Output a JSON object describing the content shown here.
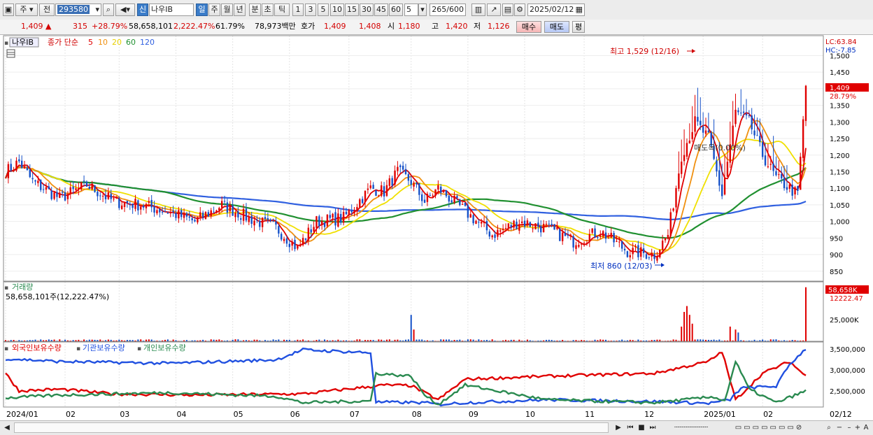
{
  "toolbar": {
    "type1": "주",
    "type2": "전",
    "code": "293580",
    "name": "나우IB",
    "new_label": "신",
    "periods": [
      "일",
      "주",
      "월",
      "년",
      "분",
      "초",
      "틱"
    ],
    "intervals": [
      "1",
      "3",
      "5",
      "10",
      "15",
      "30",
      "45",
      "60"
    ],
    "interval_value": "5",
    "count": "265/600",
    "date": "2025/02/12"
  },
  "quote": {
    "price": "1,409 ▲",
    "change": "315",
    "change_pct": "+28.79%",
    "volume": "58,658,101",
    "volume_pct": "2,222.47%",
    "turnover": "61.79%",
    "amount": "78,973백만",
    "bid_label": "호가",
    "ask": "1,409",
    "bid": "1,408",
    "open_label": "시",
    "open": "1,180",
    "high_label": "고",
    "high": "1,420",
    "low_label": "저",
    "low": "1,126",
    "buy": "매수",
    "sell": "매도",
    "flat": "평"
  },
  "price_panel": {
    "name_tag": "나우IB",
    "legend_title": "종가 단순",
    "ma_labels": [
      "5",
      "10",
      "20",
      "60",
      "120"
    ],
    "ma_colors": [
      "#e00000",
      "#f09010",
      "#f0e000",
      "#209030",
      "#3060e0"
    ],
    "max_label": "최고 1,529 (12/16)",
    "min_label": "최저 860 (12/03)",
    "note": "매도목(0.00%)",
    "lc": "LC:63.84",
    "hc": "HC:-7.85",
    "last_price": "1,409",
    "last_pct": "28.79%",
    "y_ticks": [
      "1,500",
      "1,450",
      "1,400",
      "1,350",
      "1,300",
      "1,250",
      "1,200",
      "1,150",
      "1,100",
      "1,050",
      "1,000",
      "950",
      "900",
      "850"
    ]
  },
  "volume_panel": {
    "title": "거래량",
    "value": "58,658,101주(12,222.47%)",
    "last": "58,658K",
    "last_pct": "12222.47",
    "y_tick": "25,000K"
  },
  "holding_panel": {
    "foreign": "외국인보유수량",
    "inst": "기관보유수량",
    "indiv": "개인보유수량",
    "y_ticks": [
      "3,500,000",
      "3,000,000",
      "2,500,000"
    ]
  },
  "x_labels": [
    "2024/01",
    "02",
    "03",
    "04",
    "05",
    "06",
    "07",
    "08",
    "09",
    "10",
    "11",
    "12",
    "2025/01",
    "02",
    "02/12"
  ],
  "colors": {
    "up": "#e00000",
    "down": "#1450c8",
    "foreign": "#e00000",
    "inst": "#2050e0",
    "indiv": "#2a8a50"
  },
  "chart_data": {
    "type": "line",
    "price_anchors": [
      [
        0,
        1150
      ],
      [
        5,
        1180
      ],
      [
        10,
        1120
      ],
      [
        20,
        1070
      ],
      [
        30,
        1110
      ],
      [
        40,
        1060
      ],
      [
        50,
        1050
      ],
      [
        60,
        1030
      ],
      [
        70,
        1000
      ],
      [
        80,
        1050
      ],
      [
        90,
        1010
      ],
      [
        100,
        980
      ],
      [
        108,
        920
      ],
      [
        115,
        1000
      ],
      [
        125,
        1010
      ],
      [
        135,
        1100
      ],
      [
        140,
        1090
      ],
      [
        145,
        1150
      ],
      [
        150,
        1120
      ],
      [
        155,
        1060
      ],
      [
        160,
        1100
      ],
      [
        170,
        1030
      ],
      [
        180,
        960
      ],
      [
        190,
        1000
      ],
      [
        200,
        980
      ],
      [
        210,
        940
      ],
      [
        220,
        970
      ],
      [
        230,
        910
      ],
      [
        240,
        900
      ],
      [
        245,
        960
      ],
      [
        250,
        1200
      ],
      [
        255,
        1300
      ],
      [
        260,
        1250
      ],
      [
        265,
        1080
      ],
      [
        270,
        1330
      ],
      [
        275,
        1300
      ],
      [
        280,
        1200
      ],
      [
        285,
        1130
      ],
      [
        290,
        1100
      ],
      [
        293,
        1080
      ],
      [
        296,
        1409
      ]
    ],
    "foreign_anchors": [
      [
        0,
        0.55
      ],
      [
        5,
        0.25
      ],
      [
        20,
        0.28
      ],
      [
        40,
        0.2
      ],
      [
        70,
        0.18
      ],
      [
        110,
        0.2
      ],
      [
        140,
        0.35
      ],
      [
        150,
        0.34
      ],
      [
        160,
        0.1
      ],
      [
        170,
        0.45
      ],
      [
        200,
        0.5
      ],
      [
        240,
        0.55
      ],
      [
        260,
        0.75
      ],
      [
        265,
        0.92
      ],
      [
        270,
        0.1
      ],
      [
        280,
        0.55
      ],
      [
        290,
        0.75
      ],
      [
        296,
        0.5
      ]
    ],
    "inst_anchors": [
      [
        0,
        0.8
      ],
      [
        20,
        0.75
      ],
      [
        60,
        0.72
      ],
      [
        100,
        0.78
      ],
      [
        110,
        0.95
      ],
      [
        135,
        0.9
      ],
      [
        137,
        0.06
      ],
      [
        155,
        0.05
      ],
      [
        160,
        0.02
      ],
      [
        170,
        0.05
      ],
      [
        200,
        0.1
      ],
      [
        240,
        0.07
      ],
      [
        260,
        0.04
      ],
      [
        268,
        0.1
      ],
      [
        272,
        0.3
      ],
      [
        285,
        0.33
      ],
      [
        290,
        0.7
      ],
      [
        296,
        0.97
      ]
    ],
    "indiv_anchors": [
      [
        0,
        0.13
      ],
      [
        20,
        0.18
      ],
      [
        60,
        0.22
      ],
      [
        100,
        0.16
      ],
      [
        110,
        0.05
      ],
      [
        135,
        0.08
      ],
      [
        137,
        0.55
      ],
      [
        150,
        0.5
      ],
      [
        155,
        0.18
      ],
      [
        160,
        0.02
      ],
      [
        170,
        0.35
      ],
      [
        200,
        0.1
      ],
      [
        240,
        0.05
      ],
      [
        262,
        0.15
      ],
      [
        266,
        0.08
      ],
      [
        270,
        0.75
      ],
      [
        275,
        0.28
      ],
      [
        285,
        0.05
      ],
      [
        296,
        0.25
      ]
    ]
  }
}
